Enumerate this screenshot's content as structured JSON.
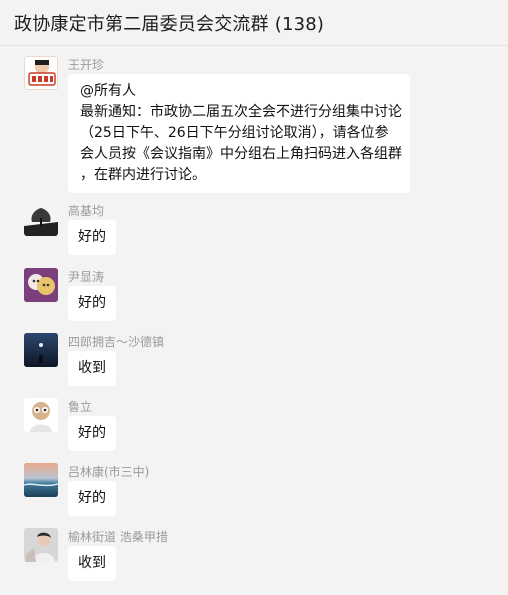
{
  "window": {
    "title": "政协康定市第二届委员会交流群 (138)"
  },
  "messages": [
    {
      "sender": "王开珍",
      "lines": [
        "@所有人",
        "最新通知：市政协二届五次全会不进行分组集中讨论",
        "（25日下午、26日下午分组讨论取消），请各位参",
        "会人员按《会议指南》中分组右上角扫码进入各组群",
        "，在群内进行讨论。"
      ]
    },
    {
      "sender": "高基均",
      "text": "好的"
    },
    {
      "sender": "尹显涛",
      "text": "好的"
    },
    {
      "sender": "四郎拥吉～沙德镇",
      "text": "收到"
    },
    {
      "sender": "鲁立",
      "text": "好的"
    },
    {
      "sender": "吕林康(市三中)",
      "text": "好的"
    },
    {
      "sender": "榆林街道 浩桑甲措",
      "text": "收到"
    }
  ],
  "colors": {
    "background": "#f3f3f3",
    "bubble": "#ffffff",
    "sender_name": "#9a9a9a",
    "text": "#111111"
  }
}
